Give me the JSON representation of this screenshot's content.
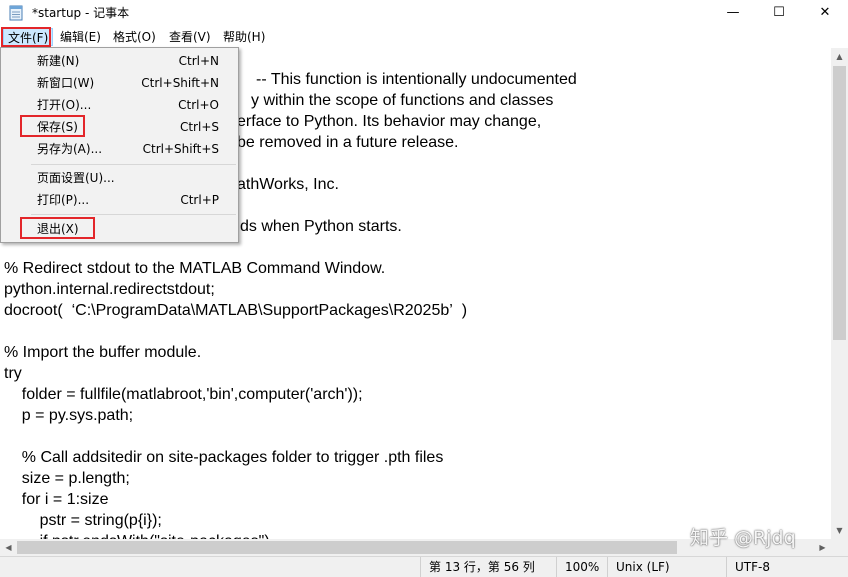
{
  "window": {
    "title": "*startup - 记事本",
    "minimize_glyph": "—",
    "maximize_glyph": "☐",
    "close_glyph": "✕",
    "icon": "notepad-icon"
  },
  "menubar": {
    "items": [
      "文件(F)",
      "编辑(E)",
      "格式(O)",
      "查看(V)",
      "帮助(H)"
    ]
  },
  "file_menu": {
    "items": [
      {
        "label": "新建(N)",
        "shortcut": "Ctrl+N"
      },
      {
        "label": "新窗口(W)",
        "shortcut": "Ctrl+Shift+N"
      },
      {
        "label": "打开(O)...",
        "shortcut": "Ctrl+O"
      },
      {
        "label": "保存(S)",
        "shortcut": "Ctrl+S"
      },
      {
        "label": "另存为(A)...",
        "shortcut": "Ctrl+Shift+S"
      },
      {
        "label": "页面设置(U)...",
        "shortcut": ""
      },
      {
        "label": "打印(P)...",
        "shortcut": "Ctrl+P"
      },
      {
        "label": "退出(X)",
        "shortcut": ""
      }
    ]
  },
  "editor": {
    "lines": [
      "-- This function is intentionally undocumented",
      "y within the scope of functions and classes",
      "erface to Python. Its behavior may change,",
      "be removed in a future release.",
      "athWorks, Inc.",
      "ds when Python starts.",
      "% Redirect stdout to the MATLAB Command Window.",
      "python.internal.redirectstdout;",
      "docroot(  ‘C:\\ProgramData\\MATLAB\\SupportPackages\\R2025b’  )",
      "% Import the buffer module.",
      "try",
      "    folder = fullfile(matlabroot,'bin',computer('arch'));",
      "    p = py.sys.path;",
      "    % Call addsitedir on site-packages folder to trigger .pth files",
      "    size = p.length;",
      "    for i = 1:size",
      "        pstr = string(p{i});",
      "        if pstr.endsWith(\"site-packages\")"
    ]
  },
  "statusbar": {
    "position": "第 13 行，第 56 列",
    "zoom": "100%",
    "line_ending": "Unix (LF)",
    "encoding": "UTF-8"
  },
  "watermark": "知乎 @Rjdq",
  "colors": {
    "highlight_box": "#e3262a",
    "menu_active_bg": "#cce8ff"
  }
}
